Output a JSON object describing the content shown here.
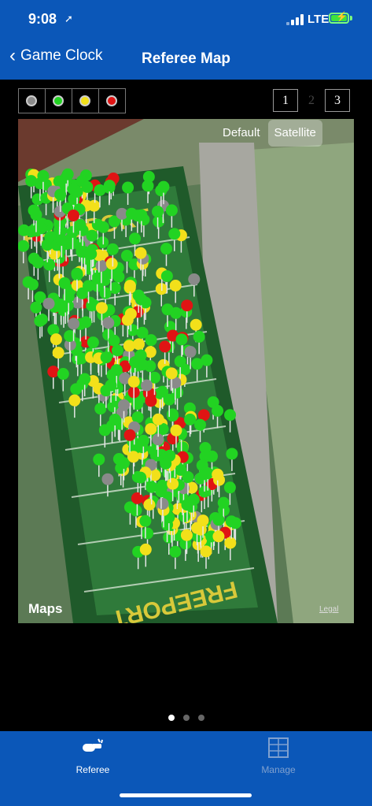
{
  "status_bar": {
    "time": "9:08",
    "carrier": "LTE"
  },
  "nav": {
    "back_label": "Game Clock",
    "title": "Referee Map"
  },
  "legend": [
    {
      "name": "gray",
      "color": "#8a8a8a"
    },
    {
      "name": "green",
      "color": "#22d322"
    },
    {
      "name": "yellow",
      "color": "#f2e01a"
    },
    {
      "name": "red",
      "color": "#e01414"
    }
  ],
  "pages": [
    "1",
    "2",
    "3"
  ],
  "map": {
    "toggle": [
      "Default",
      "Satellite"
    ],
    "selected": "Satellite",
    "field_text_top": "FREEPORT",
    "field_text_bottom": "FREEPORT",
    "attribution": "Maps",
    "legal": "Legal"
  },
  "page_indicator": {
    "count": 3,
    "active": 0
  },
  "tabs": [
    {
      "label": "Referee",
      "active": true
    },
    {
      "label": "Manage",
      "active": false
    }
  ]
}
